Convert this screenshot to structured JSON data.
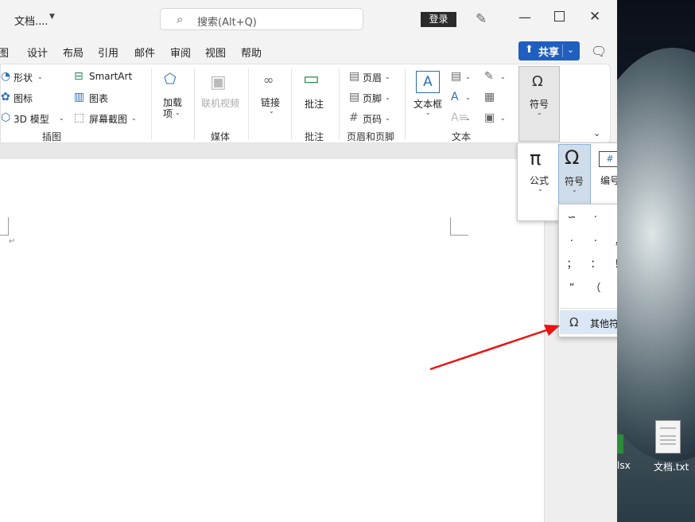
{
  "titlebar": {
    "doc_title": "文档....",
    "search_placeholder": "搜索(Alt+Q)",
    "login_label": "登录"
  },
  "tabs": [
    "图",
    "设计",
    "布局",
    "引用",
    "邮件",
    "审阅",
    "视图",
    "帮助"
  ],
  "share": {
    "label": "共享"
  },
  "ribbon": {
    "illustrations": {
      "shapes": "形状",
      "icons": "图标",
      "models3d": "3D 模型",
      "smartart": "SmartArt",
      "chart": "图表",
      "screenshot": "屏幕截图",
      "group_label": "插图"
    },
    "addins": {
      "label_line1": "加载",
      "label_line2": "项"
    },
    "media": {
      "online_video": "联机视频",
      "group_label": "媒体"
    },
    "links": {
      "label": "链接"
    },
    "comments": {
      "label": "批注",
      "group_label": "批注"
    },
    "header_footer": {
      "header": "页眉",
      "footer": "页脚",
      "page_number": "页码",
      "group_label": "页眉和页脚"
    },
    "text": {
      "textbox": "文本框",
      "group_label": "文本"
    },
    "symbols": {
      "label": "符号"
    }
  },
  "equation_panel": {
    "equation": "公式",
    "symbol": "符号",
    "number": "编号"
  },
  "symbol_panel": {
    "symbols": [
      "∽",
      "·",
      "·",
      "•",
      "·",
      "·",
      "·",
      "，",
      "。",
      "、",
      "；",
      "：",
      "！",
      "？",
      "“",
      "”",
      "（",
      "【",
      "）",
      "%"
    ],
    "more_symbols": "其他符号(M)..."
  },
  "desktop": {
    "file_label": "文档.txt",
    "xlsx_label": "lsx"
  }
}
